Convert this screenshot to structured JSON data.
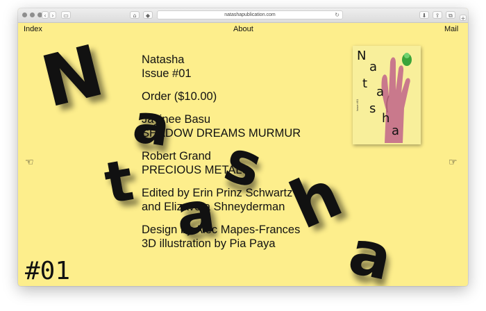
{
  "browser": {
    "url": "natashapublication.com",
    "back_glyph": "‹",
    "forward_glyph": "›",
    "sidebar_glyph": "▭",
    "home_glyph": "⌂",
    "shield_glyph": "◆",
    "reload_glyph": "↻",
    "download_glyph": "⬇",
    "share_glyph": "⇪",
    "tabs_glyph": "⧉",
    "newtab_glyph": "+"
  },
  "nav": {
    "index": "Index",
    "about": "About",
    "mail": "Mail"
  },
  "cover": {
    "letters": [
      "N",
      "a",
      "t",
      "a",
      "s",
      "h",
      "a"
    ],
    "small_text": "Issue #01",
    "hand_color": "#c9798c",
    "accent_color": "#3aa43a"
  },
  "content": {
    "title": "Natasha",
    "issue": "Issue #01",
    "order": "Order ($10.00)",
    "author1": "Jayinee Basu",
    "work1": "SHADOW DREAMS MURMUR",
    "author2": "Robert Grand",
    "work2": "PRECIOUS METALS",
    "edited_line1": "Edited by Erin Prinz Schwartz",
    "edited_line2": "and Elizaveta Shneyderman",
    "design_line1": "Design by Alec Mapes-Frances",
    "design_line2": "3D illustration by Pia Paya"
  },
  "issue_number": "#01",
  "big_letters": [
    "N",
    "a",
    "t",
    "a",
    "s",
    "h",
    "a"
  ],
  "hand_icons": {
    "left": "☜",
    "right": "☞"
  },
  "colors": {
    "background": "#fdee8c",
    "text": "#111111"
  }
}
